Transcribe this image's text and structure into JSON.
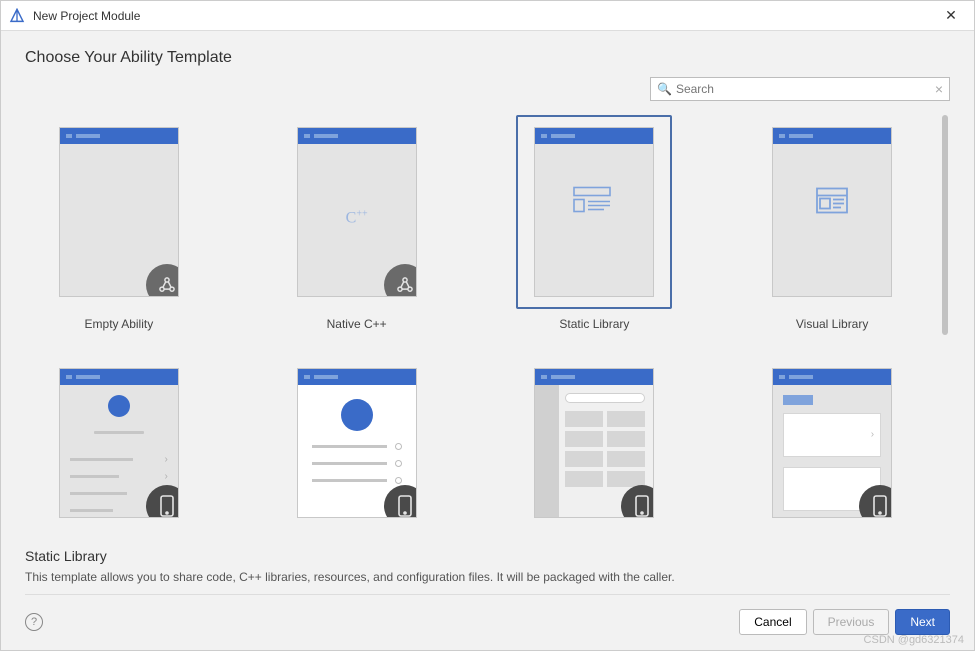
{
  "window": {
    "title": "New Project Module"
  },
  "heading": "Choose Your Ability Template",
  "search": {
    "placeholder": "Search"
  },
  "templates": [
    {
      "label": "Empty Ability",
      "selected": false
    },
    {
      "label": "Native C++",
      "selected": false
    },
    {
      "label": "Static Library",
      "selected": true
    },
    {
      "label": "Visual Library",
      "selected": false
    }
  ],
  "description": {
    "title": "Static Library",
    "text": "This template allows you to share code, C++ libraries, resources, and configuration files. It will be packaged with the caller."
  },
  "footer": {
    "cancel": "Cancel",
    "previous": "Previous",
    "next": "Next"
  },
  "watermark": "CSDN @gd6321374"
}
